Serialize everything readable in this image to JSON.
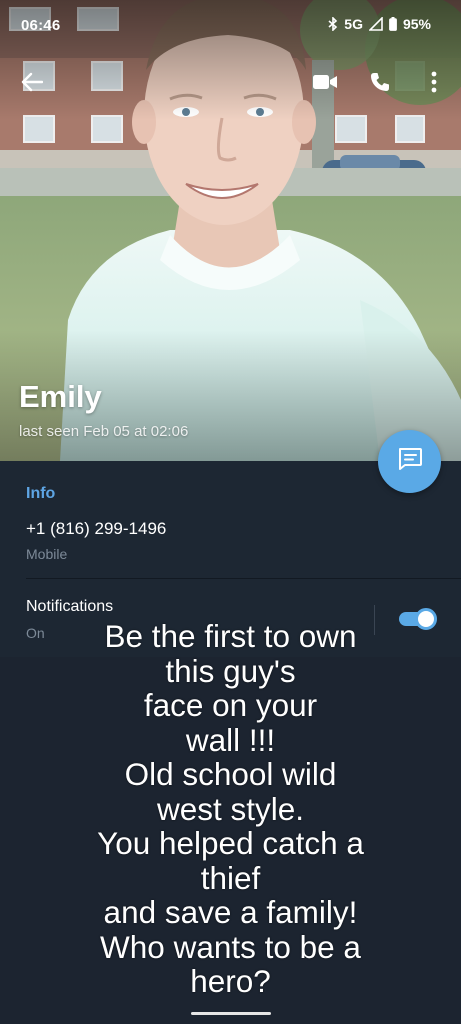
{
  "status_bar": {
    "time": "06:46",
    "network": "5G",
    "battery": "95%",
    "icons": [
      "bluetooth-icon",
      "signal-icon",
      "battery-icon"
    ]
  },
  "top_bar": {
    "icons": [
      "back-arrow-icon",
      "video-camera-icon",
      "phone-icon",
      "more-vert-icon"
    ]
  },
  "profile": {
    "name": "Emily",
    "last_seen": "last seen Feb 05 at 02:06"
  },
  "fab": {
    "icon": "message-icon"
  },
  "info": {
    "header": "Info",
    "phone": "+1 (816) 299-1496",
    "phone_type": "Mobile",
    "notifications_label": "Notifications",
    "notifications_state": "On",
    "notifications_enabled": true
  },
  "caption": {
    "text": "Be the first to own\nthis guy's\n face on your\nwall !!!\nOld school wild\nwest style.\nYou helped catch a\nthief\nand save a family!\nWho wants to be a\nhero?"
  },
  "colors": {
    "accent": "#5aa9e6",
    "panel_bg": "#1d2733",
    "page_bg": "#1c2430",
    "secondary_text": "#7d8a98"
  }
}
